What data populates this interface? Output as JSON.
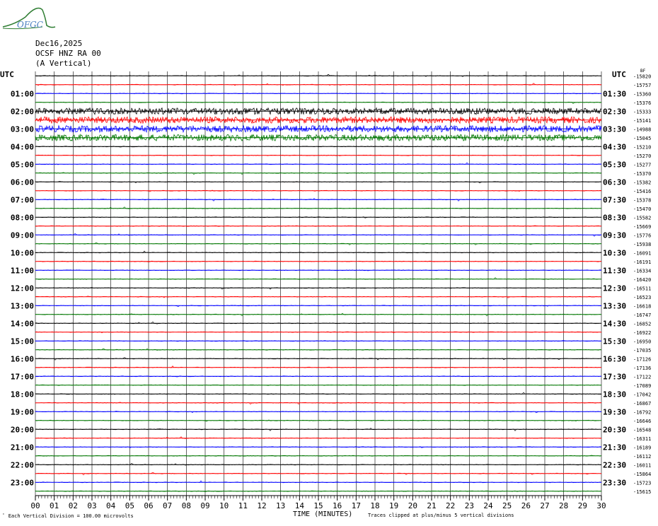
{
  "logo": {
    "text": "OFGC",
    "color": "#2e7d32",
    "text_color": "#4a7fc1"
  },
  "header": {
    "date": "Dec16,2025",
    "station": "OCSF HNZ RA 00",
    "component": "(A Vertical)"
  },
  "footer": {
    "scale_note": "Each Vertical Division =  100.00 microvolts",
    "clip_note": "Traces clipped at plus/minus 5 vertical divisions",
    "small_mark": "ﾟ"
  },
  "colors": {
    "black": "#000000",
    "red": "#ff0000",
    "blue": "#0000ff",
    "green": "#007700",
    "grid": "#000000"
  },
  "chart_data": {
    "type": "line",
    "title": "",
    "xlabel": "TIME (MINUTES)",
    "ylabel": "",
    "xlim": [
      0,
      30
    ],
    "x_ticks": [
      "00",
      "01",
      "02",
      "03",
      "04",
      "05",
      "06",
      "07",
      "08",
      "09",
      "10",
      "11",
      "12",
      "13",
      "14",
      "15",
      "16",
      "17",
      "18",
      "19",
      "20",
      "21",
      "22",
      "23",
      "24",
      "25",
      "26",
      "27",
      "28",
      "29",
      "30"
    ],
    "left_axis_title": "UTC",
    "right_axis_title": "UTC",
    "left_labels": [
      "01:00",
      "02:00",
      "03:00",
      "04:00",
      "05:00",
      "06:00",
      "07:00",
      "08:00",
      "09:00",
      "10:00",
      "11:00",
      "12:00",
      "13:00",
      "14:00",
      "15:00",
      "16:00",
      "17:00",
      "18:00",
      "19:00",
      "20:00",
      "21:00",
      "22:00",
      "23:00"
    ],
    "right_labels": [
      "01:30",
      "02:30",
      "03:30",
      "04:30",
      "05:30",
      "06:30",
      "07:30",
      "08:30",
      "09:30",
      "10:30",
      "11:30",
      "12:30",
      "13:30",
      "14:30",
      "15:30",
      "16:30",
      "17:30",
      "18:30",
      "19:30",
      "20:30",
      "21:30",
      "22:30",
      "23:30"
    ],
    "trace_colors": [
      "black",
      "red",
      "blue",
      "green"
    ],
    "trace_means": [
      "-15820",
      "-15757",
      "-15360",
      "-15376",
      "-15333",
      "-15141",
      "-14988",
      "-15045",
      "-15210",
      "-15270",
      "-15277",
      "-15370",
      "-15382",
      "-15416",
      "-15378",
      "-15470",
      "-15582",
      "-15669",
      "-15776",
      "-15938",
      "-16091",
      "-16191",
      "-16334",
      "-16420",
      "-16511",
      "-16523",
      "-16618",
      "-16747",
      "-16852",
      "-16922",
      "-16950",
      "-17035",
      "-17126",
      "-17136",
      "-17122",
      "-17089",
      "-17042",
      "-16867",
      "-16792",
      "-16646",
      "-16548",
      "-16311",
      "-16189",
      "-16112",
      "-16011",
      "-15864",
      "-15723",
      "-15615"
    ],
    "trace_activity": [
      2,
      1,
      1,
      1,
      5,
      5,
      5,
      5,
      2,
      2,
      1,
      1,
      1,
      1,
      1,
      1,
      1,
      1,
      1,
      1,
      1,
      1,
      1,
      1,
      1,
      1,
      1,
      1,
      1,
      1,
      1,
      1,
      1,
      1,
      1,
      1,
      1,
      1,
      1,
      1,
      1,
      1,
      1,
      1,
      1,
      1,
      1,
      1
    ],
    "corner_label": "BF"
  }
}
